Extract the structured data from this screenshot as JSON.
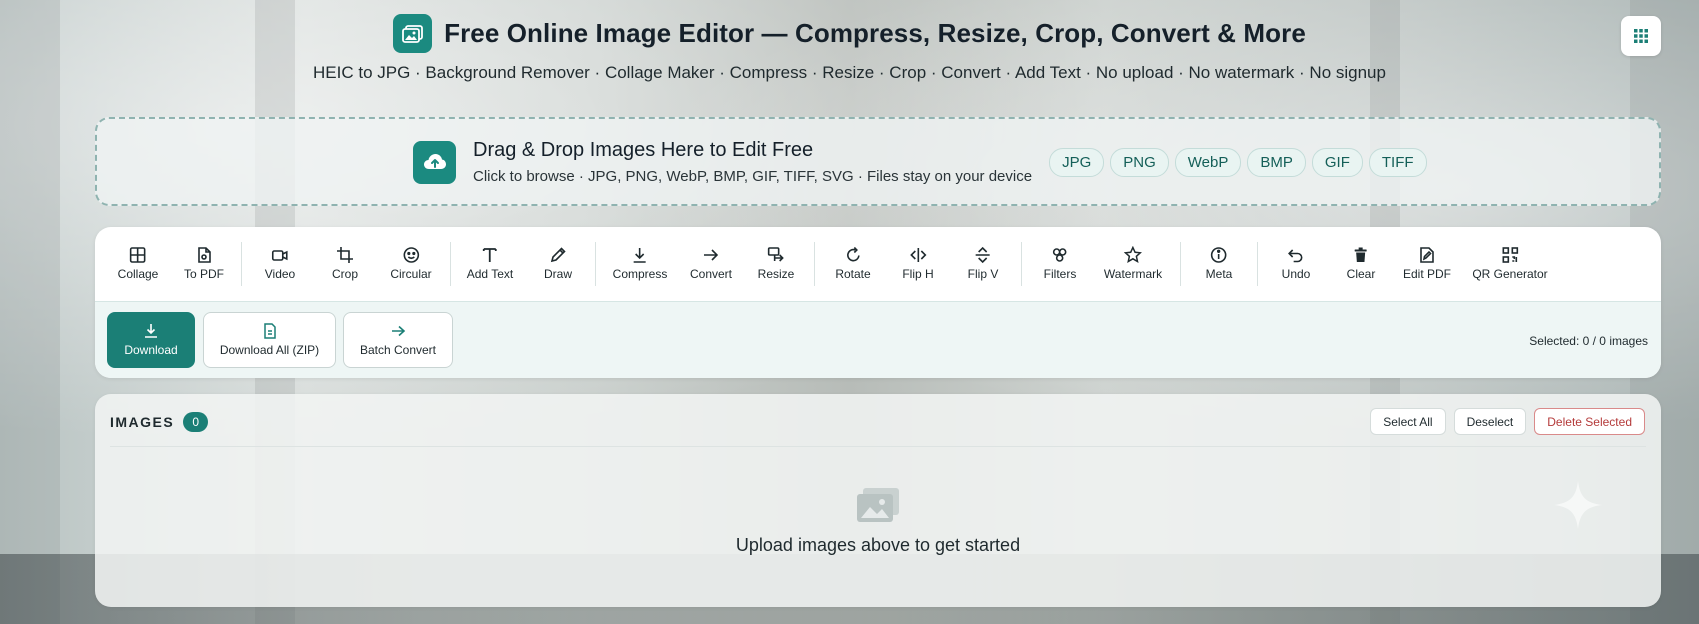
{
  "header": {
    "title": "Free Online Image Editor — Compress, Resize, Crop, Convert & More",
    "subtitle": "HEIC to JPG · Background Remover · Collage Maker · Compress · Resize · Crop · Convert · Add Text · No upload · No watermark · No signup"
  },
  "dropzone": {
    "title": "Drag & Drop Images Here to Edit Free",
    "subtitle": "Click to browse · JPG, PNG, WebP, BMP, GIF, TIFF, SVG · Files stay on your device",
    "formats": [
      "JPG",
      "PNG",
      "WebP",
      "BMP",
      "GIF",
      "TIFF"
    ]
  },
  "toolbar": {
    "tools": [
      {
        "label": "Collage",
        "icon": "grid-icon"
      },
      {
        "label": "To PDF",
        "icon": "pdf-file-icon"
      },
      {
        "label": "Video",
        "icon": "video-icon"
      },
      {
        "label": "Crop",
        "icon": "crop-icon"
      },
      {
        "label": "Circular",
        "icon": "circle-face-icon"
      },
      {
        "label": "Add Text",
        "icon": "text-icon"
      },
      {
        "label": "Draw",
        "icon": "pencil-icon"
      },
      {
        "label": "Compress",
        "icon": "download-arrow-icon"
      },
      {
        "label": "Convert",
        "icon": "arrow-right-icon"
      },
      {
        "label": "Resize",
        "icon": "resize-icon"
      },
      {
        "label": "Rotate",
        "icon": "rotate-icon"
      },
      {
        "label": "Flip H",
        "icon": "flip-horizontal-icon"
      },
      {
        "label": "Flip V",
        "icon": "flip-vertical-icon"
      },
      {
        "label": "Filters",
        "icon": "filters-icon"
      },
      {
        "label": "Watermark",
        "icon": "star-icon"
      },
      {
        "label": "Meta",
        "icon": "info-icon"
      },
      {
        "label": "Undo",
        "icon": "undo-icon"
      },
      {
        "label": "Clear",
        "icon": "trash-icon"
      },
      {
        "label": "Edit PDF",
        "icon": "edit-file-icon"
      },
      {
        "label": "QR Generator",
        "icon": "qr-icon"
      }
    ]
  },
  "actions": {
    "download": "Download",
    "download_all": "Download All (ZIP)",
    "batch_convert": "Batch Convert",
    "selected_info": "Selected: 0 / 0 images"
  },
  "images": {
    "title": "IMAGES",
    "count": "0",
    "select_all": "Select All",
    "deselect": "Deselect",
    "delete_selected": "Delete Selected",
    "empty_text": "Upload images above to get started"
  },
  "colors": {
    "accent": "#1b8a80",
    "accent_dark": "#1b7f76",
    "danger": "#b43a3a"
  }
}
